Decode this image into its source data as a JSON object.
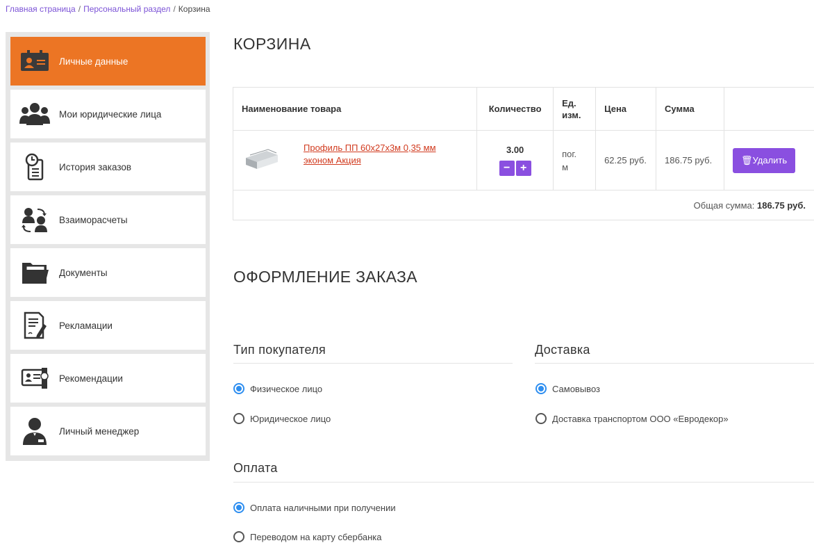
{
  "breadcrumb": {
    "home": "Главная страница",
    "personal": "Персональный раздел",
    "current": "Корзина",
    "separator": "/"
  },
  "sidebar": {
    "items": [
      {
        "label": "Личные данные",
        "icon": "id-card-icon",
        "active": true
      },
      {
        "label": "Мои юридические лица",
        "icon": "users-group-icon"
      },
      {
        "label": "История заказов",
        "icon": "order-history-icon"
      },
      {
        "label": "Взаиморасчеты",
        "icon": "settlements-icon"
      },
      {
        "label": "Документы",
        "icon": "folder-documents-icon"
      },
      {
        "label": "Рекламации",
        "icon": "claim-edit-icon"
      },
      {
        "label": "Рекомендации",
        "icon": "certificate-icon"
      },
      {
        "label": "Личный менеджер",
        "icon": "manager-icon"
      }
    ]
  },
  "cart": {
    "title": "КОРЗИНА",
    "headers": {
      "name": "Наименование товара",
      "qty": "Количество",
      "unit_line1": "Ед.",
      "unit_line2": "изм.",
      "price": "Цена",
      "sum": "Сумма"
    },
    "items": [
      {
        "name_line1": "Профиль ПП 60х27х3м 0,35 мм",
        "name_line2": "эконом Акция",
        "qty": "3.00",
        "unit_line1": "пог.",
        "unit_line2": "м",
        "price": "62.25 руб.",
        "sum": "186.75 руб.",
        "delete_label": "Удалить"
      }
    ],
    "total_label": "Общая сумма:",
    "total_value": "186.75 руб."
  },
  "checkout": {
    "title": "ОФОРМЛЕНИЕ ЗАКАЗА",
    "buyer_type": {
      "title": "Тип покупателя",
      "options": [
        "Физическое лицо",
        "Юридическое лицо"
      ],
      "selected": 0
    },
    "delivery": {
      "title": "Доставка",
      "options": [
        "Самовывоз",
        "Доставка транспортом ООО «Евродекор»"
      ],
      "selected": 0
    },
    "payment": {
      "title": "Оплата",
      "options": [
        "Оплата наличными при получении",
        "Переводом на карту сбербанка"
      ],
      "selected": 0
    }
  },
  "colors": {
    "accent_orange": "#ec7524",
    "accent_purple": "#8a4fe0",
    "radio_blue": "#2e8ef0",
    "link_red": "#d13a1e"
  }
}
